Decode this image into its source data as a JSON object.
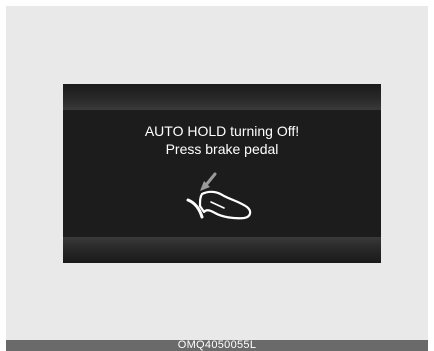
{
  "display": {
    "message_line1": "AUTO HOLD turning Off!",
    "message_line2": "Press brake pedal",
    "icon": "foot-on-brake-pedal-icon"
  },
  "footer": {
    "code": "OMQ4050055L"
  },
  "colors": {
    "panel_background": "#e9e9e9",
    "display_background": "#1c1c1c",
    "text": "#ffffff",
    "footer_bar": "#6a6a6a"
  }
}
